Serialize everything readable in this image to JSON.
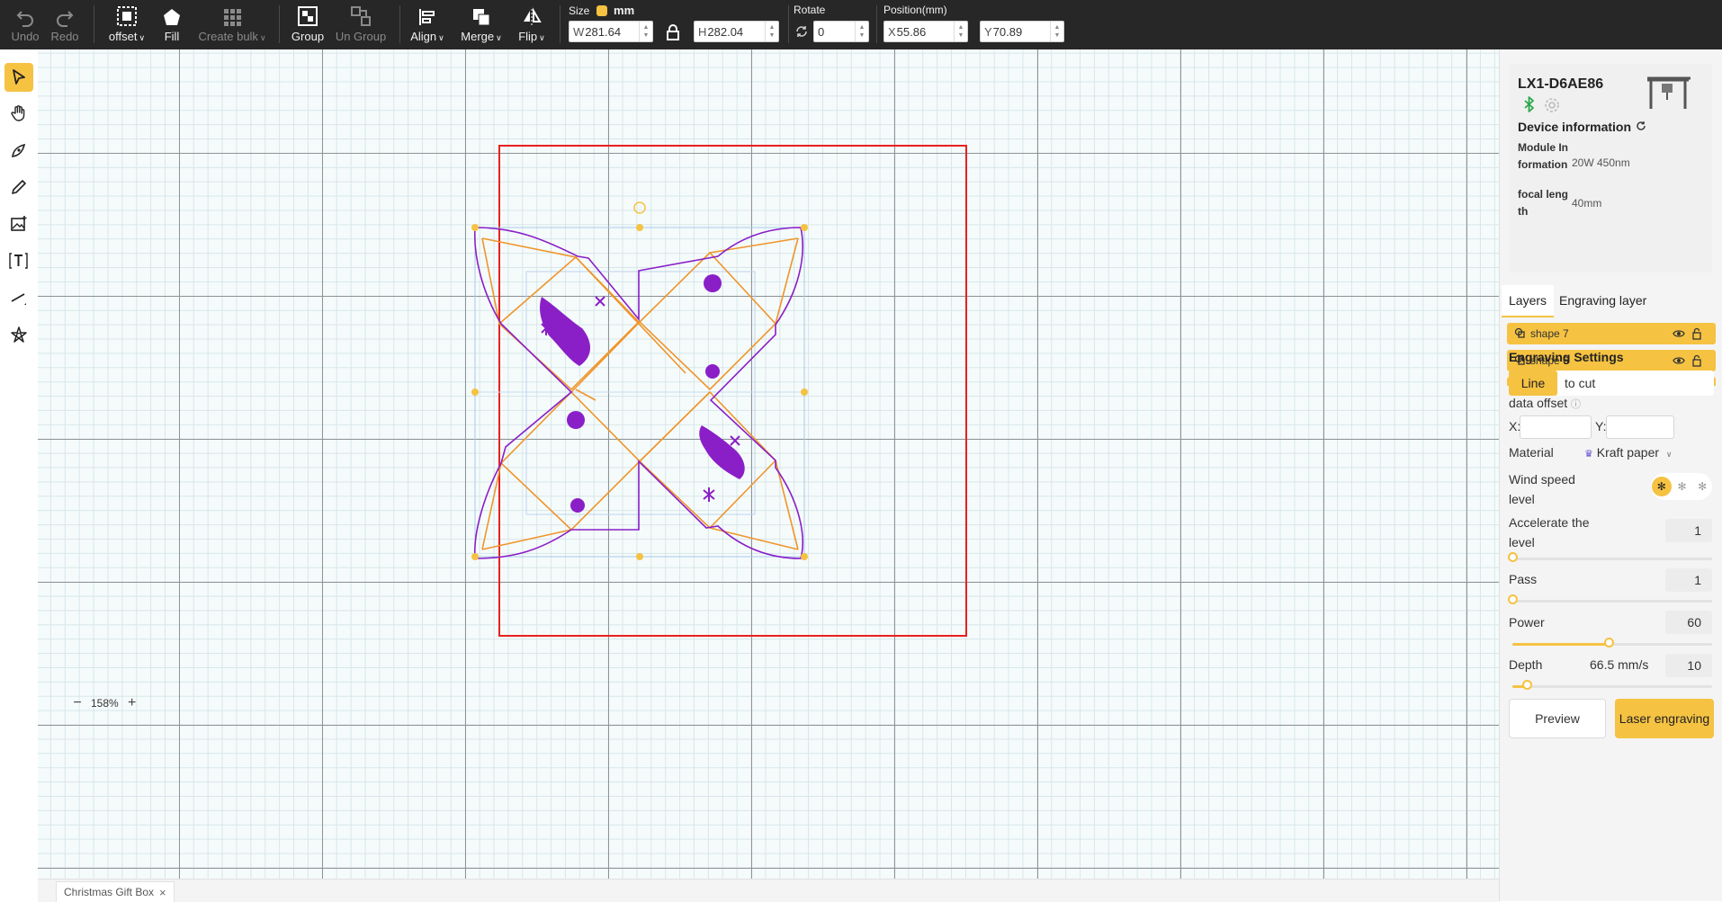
{
  "toolbar": {
    "undo": "Undo",
    "redo": "Redo",
    "offset": "offset",
    "fill": "Fill",
    "create_bulk": "Create bulk",
    "group": "Group",
    "ungroup": "Un Group",
    "align": "Align",
    "merge": "Merge",
    "flip": "Flip",
    "size_label": "Size",
    "unit": "mm",
    "width_prefix": "W",
    "width": "281.64",
    "height_prefix": "H",
    "height": "282.04",
    "rotate_label": "Rotate",
    "rotate": "0",
    "position_label": "Position(mm)",
    "x_prefix": "X",
    "x": "55.86",
    "y_prefix": "Y",
    "y": "70.89"
  },
  "left_tools": [
    "select-tool",
    "hand-tool",
    "pen-tool",
    "pencil-tool",
    "image-tool",
    "text-tool",
    "line-tool",
    "shape-tool"
  ],
  "canvas": {
    "zoom": "158%",
    "file_tab": "Christmas Gift Box",
    "accent_color": "#f5c242",
    "work_area_color": "#e82020",
    "cut_color": "#8a1fc7",
    "score_color": "#f0952a"
  },
  "device": {
    "name": "LX1-D6AE86",
    "info_title": "Device information",
    "module_key": "Module Information",
    "module_value": "20W 450nm",
    "focal_key": "focal length",
    "focal_value": "40mm"
  },
  "tabs": {
    "layers": "Layers",
    "engraving_layer": "Engraving layer"
  },
  "layers": [
    {
      "name": "shape 7"
    },
    {
      "name": "shape 6"
    },
    {
      "name": ""
    }
  ],
  "settings": {
    "title": "Engraving Settings",
    "mode_on": "Line",
    "mode_off": "to cut",
    "data_offset": "data offset",
    "x_label": "X:",
    "y_label": "Y:",
    "material_label": "Material",
    "material_value": "Kraft paper",
    "wind_label": "Wind speed level",
    "accelerate_label": "Accelerate the level",
    "accelerate_value": "1",
    "accelerate_level": 0,
    "pass_label": "Pass",
    "pass_value": "1",
    "pass_level": 0,
    "power_label": "Power",
    "power_value": "60",
    "power_level": 0.48,
    "depth_label": "Depth",
    "speed_value": "66.5 mm/s",
    "depth_value": "10",
    "depth_level": 0.07
  },
  "buttons": {
    "preview": "Preview",
    "laser": "Laser engraving"
  }
}
